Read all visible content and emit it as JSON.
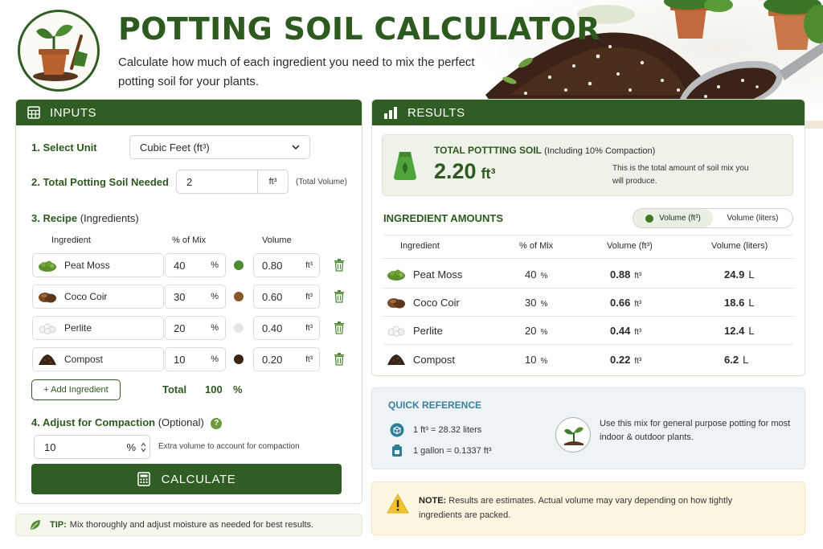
{
  "header": {
    "title": "POTTING SOIL CALCULATOR",
    "subtitle": "Calculate how much of each ingredient you need to mix the perfect potting soil for your plants."
  },
  "inputs": {
    "heading": "INPUTS",
    "unit_label": "1. Select Unit",
    "unit_value": "Cubic Feet (ft³)",
    "total_label": "2. Total Potting Soil Needed",
    "total_value": "2",
    "total_unit": "ft³",
    "total_note": "(Total Volume)",
    "recipe_label": "3. Recipe",
    "recipe_sub": "(Ingredients)",
    "col_ingredient": "Ingredient",
    "col_pct": "% of Mix",
    "col_volume": "Volume",
    "pct_unit": "%",
    "vol_unit": "ft³",
    "ingredients": [
      {
        "name": "Peat Moss",
        "pct": "40",
        "volume": "0.80",
        "color": "#4b8a2f"
      },
      {
        "name": "Coco Coir",
        "pct": "30",
        "volume": "0.60",
        "color": "#8a5628"
      },
      {
        "name": "Perlite",
        "pct": "20",
        "volume": "0.40",
        "color": "#e6e6e6"
      },
      {
        "name": "Compost",
        "pct": "10",
        "volume": "0.20",
        "color": "#3a2416"
      }
    ],
    "add_label": "+ Add Ingredient",
    "total_text": "Total",
    "total_pct": "100",
    "total_pct_unit": "%",
    "compaction_label": "4. Adjust for Compaction",
    "compaction_sub": "(Optional)",
    "compaction_help": "?",
    "compaction_value": "10",
    "compaction_unit": "%",
    "compaction_note": "Extra volume to account for compaction",
    "calculate_label": "CALCULATE"
  },
  "results": {
    "heading": "RESULTS",
    "total_label": "TOTAL POTTTING SOIL",
    "total_sub": "(Including 10% Compaction)",
    "total_value": "2.20",
    "total_unit": "ft³",
    "total_note": "This is the total amount of soil mix you will produce.",
    "amounts_title": "INGREDIENT AMOUNTS",
    "toggle_a": "Volume (ft³)",
    "toggle_b": "Volume (liters)",
    "col_ingredient": "Ingredient",
    "col_pct": "% of Mix",
    "col_vol_ft": "Volume (ft³)",
    "col_vol_l": "Volume (liters)",
    "pct_unit": "%",
    "ft_unit": "ft³",
    "l_unit": "L",
    "rows": [
      {
        "name": "Peat Moss",
        "pct": "40",
        "vol_ft": "0.88",
        "vol_l": "24.9"
      },
      {
        "name": "Coco Coir",
        "pct": "30",
        "vol_ft": "0.66",
        "vol_l": "18.6"
      },
      {
        "name": "Perlite",
        "pct": "20",
        "vol_ft": "0.44",
        "vol_l": "12.4"
      },
      {
        "name": "Compost",
        "pct": "10",
        "vol_ft": "0.22",
        "vol_l": "6.2"
      }
    ]
  },
  "quick_reference": {
    "title": "QUICK REFERENCE",
    "item1": "1 ft³ = 28.32 liters",
    "item2": "1 gallon = 0.1337 ft³",
    "tip": "Use this mix for general purpose potting for most indoor & outdoor plants."
  },
  "note": {
    "label": "NOTE:",
    "text": "Results are estimates. Actual volume may vary depending on how tightly ingredients are packed."
  },
  "tip": {
    "label": "TIP:",
    "text": "Mix thoroughly and adjust moisture as needed for best results."
  },
  "colors": {
    "brand_green": "#2f5d23",
    "accent_teal": "#3b7ea0",
    "note_yellow": "#f2c230"
  }
}
